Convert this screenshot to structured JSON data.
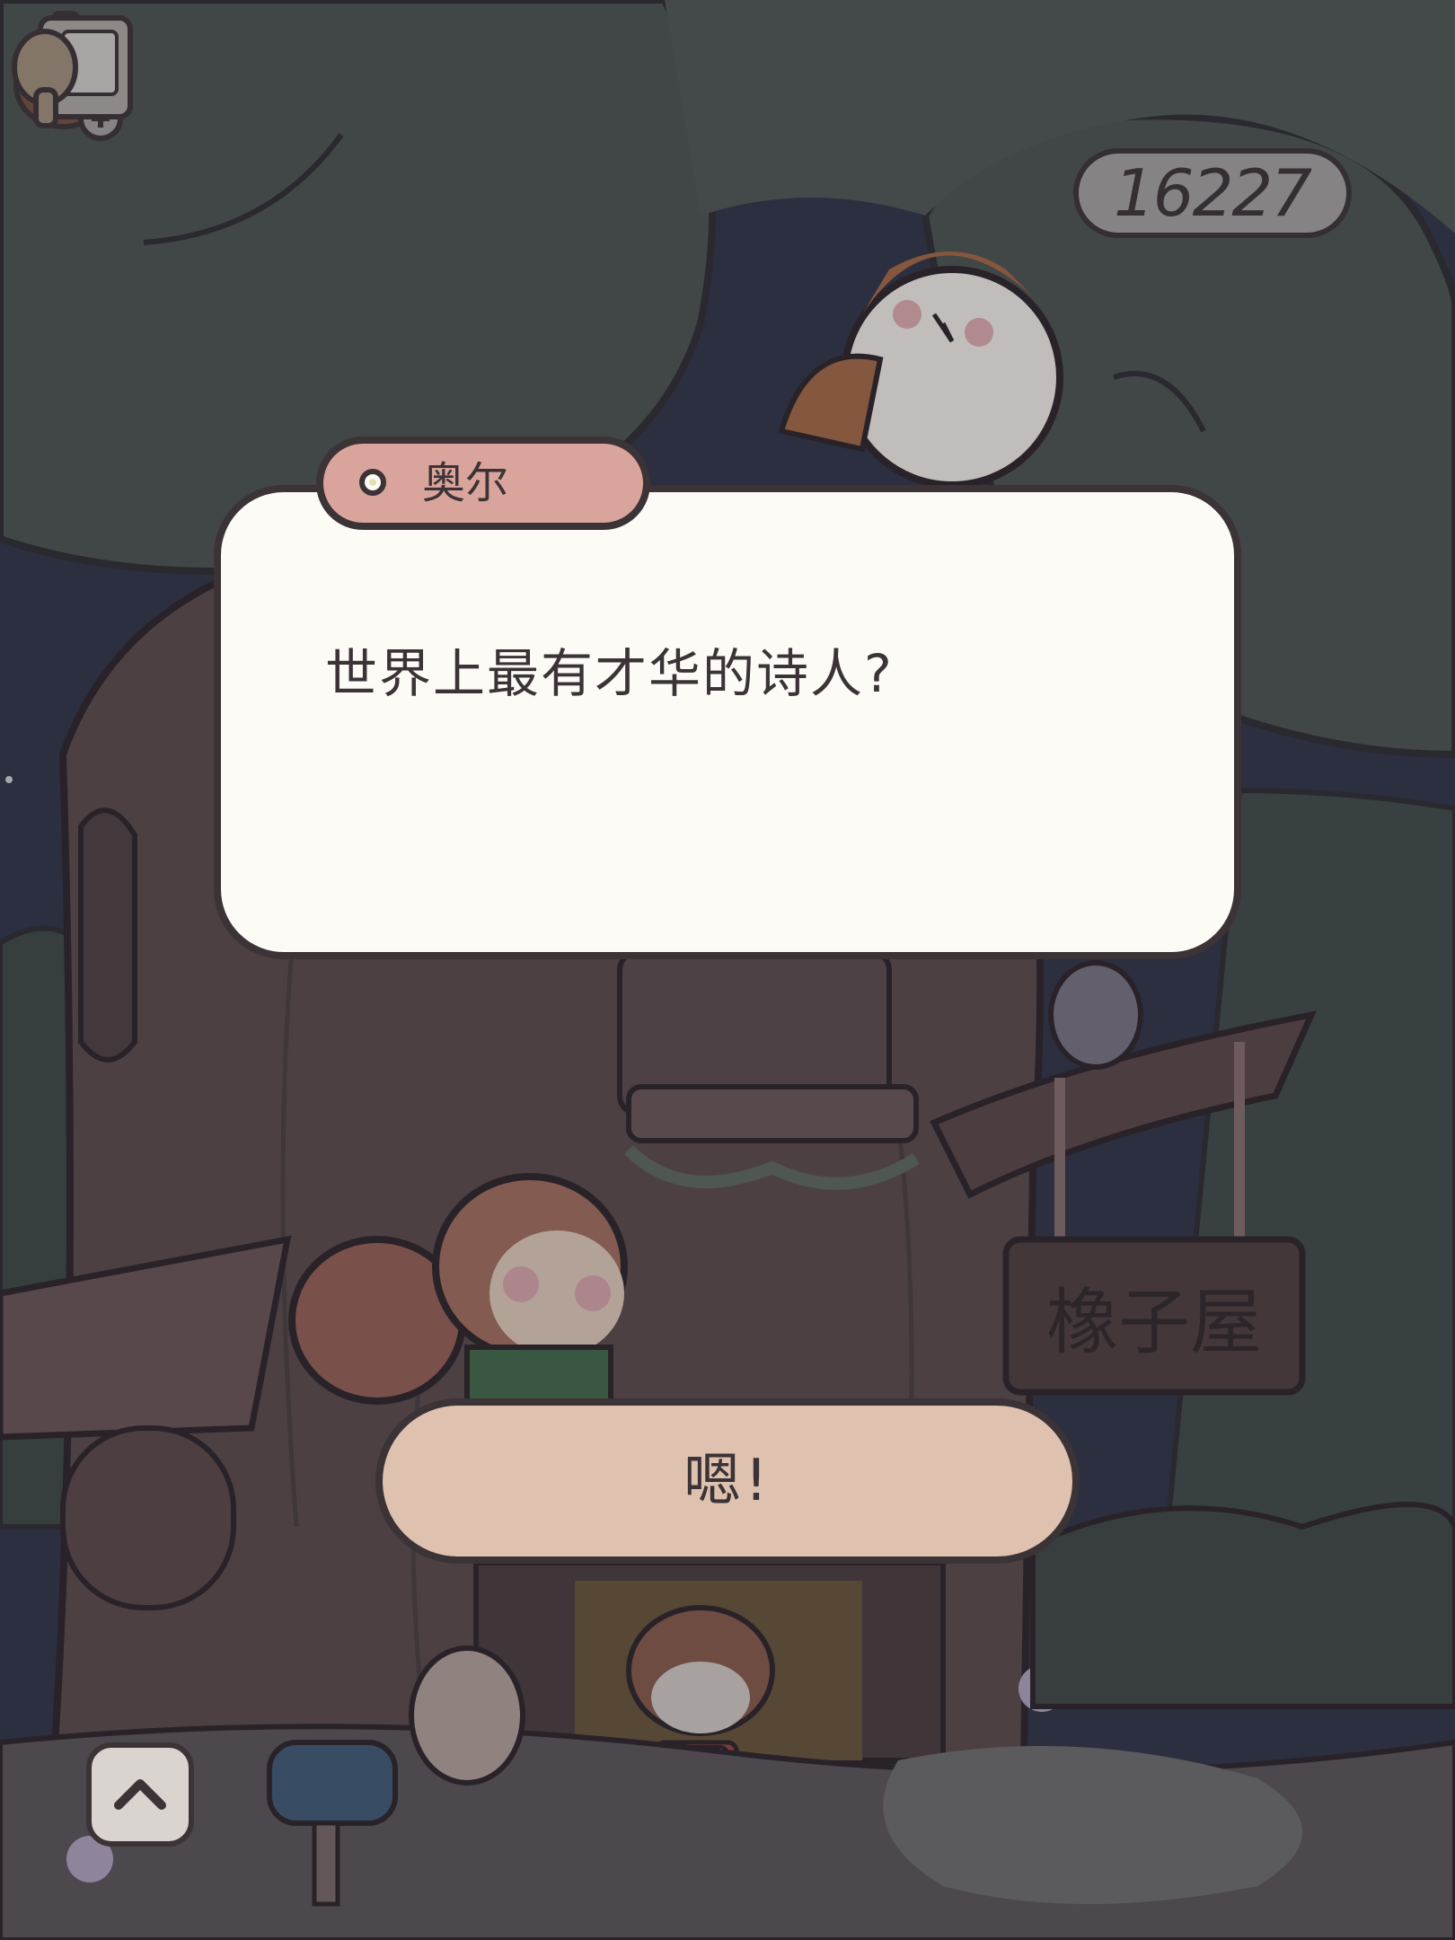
{
  "hud": {
    "acorn_count": "16227",
    "acorn_icon": "acorn-icon",
    "add_icon": "plus-icon",
    "guide_icon": "notebook-icon"
  },
  "dialog": {
    "speaker": "奥尔",
    "text": "世界上最有才华的诗人?",
    "confirm_label": "嗯!"
  },
  "scene": {
    "shop_sign": "橡子屋",
    "expand_icon": "chevron-up-icon"
  },
  "colors": {
    "dialog_bg": "#fdfbf6",
    "speaker_tab": "#d9a49b",
    "confirm_button": "#dfc1b0",
    "outline": "#3b3336",
    "foliage": "#4b5250",
    "trunk": "#5a4a4c"
  }
}
